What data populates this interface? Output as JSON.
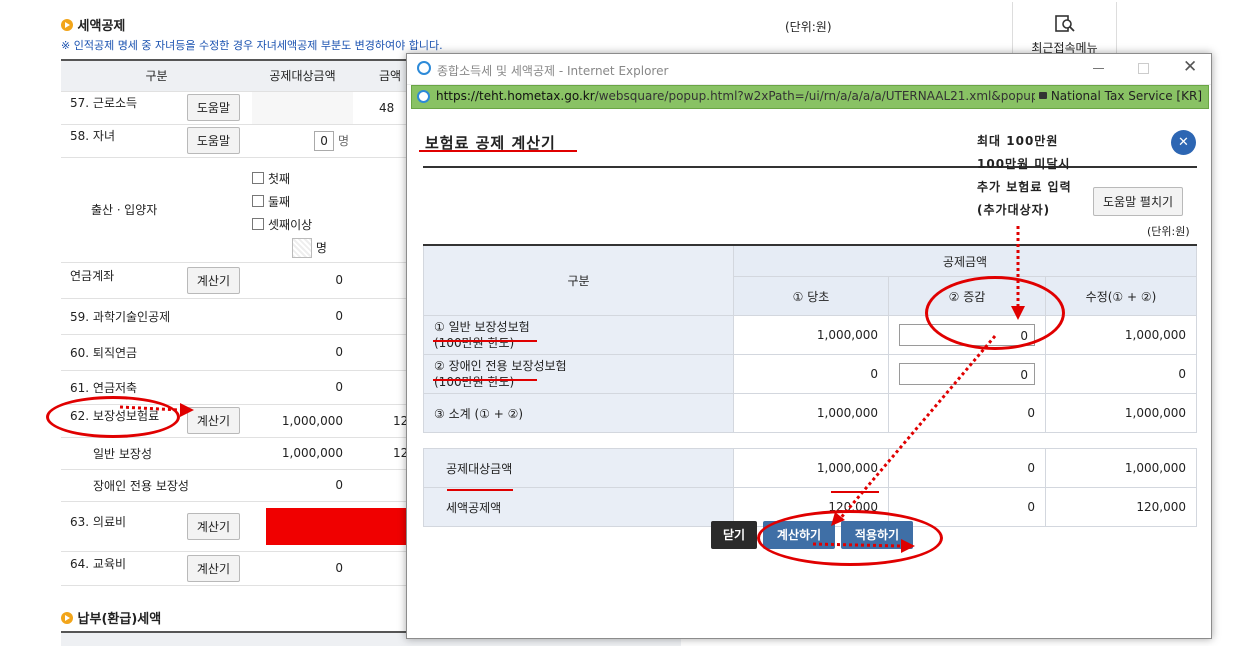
{
  "section": {
    "title": "세액공제",
    "unit": "(단위:원)",
    "notice": "※ 인적공제 명세 중 자녀등을 수정한 경우 자녀세액공제 부분도 변경하여야 합니다."
  },
  "recent_menu": {
    "label": "최근접속메뉴",
    "icon": "document-search-icon"
  },
  "table": {
    "headers": [
      "구분",
      "공제대상금액",
      "금액"
    ],
    "rows": [
      {
        "label": "57. 근로소득",
        "button": "도움말",
        "amount": "",
        "partial": "48"
      },
      {
        "label": "58. 자녀",
        "button": "도움말",
        "count": "0",
        "count_unit": "명",
        "amount": "",
        "partial": ""
      },
      {
        "label": "출산ㆍ입양자",
        "checks": [
          "첫째",
          "둘째",
          "셋째이상"
        ],
        "count_unit": "명"
      },
      {
        "label": "연금계좌",
        "button": "계산기",
        "amount": "0"
      },
      {
        "label": "59. 과학기술인공제",
        "amount": "0"
      },
      {
        "label": "60. 퇴직연금",
        "amount": "0"
      },
      {
        "label": "61. 연금저축",
        "amount": "0"
      },
      {
        "label": "62. 보장성보험료",
        "button": "계산기",
        "amount": "1,000,000",
        "partial": "12"
      },
      {
        "label": "일반 보장성",
        "amount": "1,000,000",
        "partial": "12"
      },
      {
        "label": "장애인 전용 보장성",
        "amount": "0"
      },
      {
        "label": "63. 의료비",
        "button": "계산기"
      },
      {
        "label": "64. 교육비",
        "button": "계산기",
        "amount": "0"
      }
    ]
  },
  "section2": {
    "title": "납부(환급)세액"
  },
  "popup": {
    "window_title": "종합소득세 및 세액공제 - Internet Explorer",
    "url_host": "https://teht.hometax.go.kr",
    "url_path": "/websquare/popup.html?w2xPath=/ui/rn/a/a/a/a/UTERNAAL21.xml&popupID=erinCfrl",
    "site_id": "National Tax Service [KR]",
    "heading": "보험료 공제 계산기",
    "help_button": "도움말 펼치기",
    "unit": "(단위:원)",
    "annotation": [
      "최대 100만원",
      "100만원 미달시",
      "추가 보험료 입력",
      "(추가대상자)"
    ],
    "col_group": "공제금액",
    "col_label": "구분",
    "cols": [
      "① 당초",
      "② 증감",
      "수정(① + ②)"
    ],
    "rows": [
      {
        "label1": "① 일반 보장성보험",
        "label2": "(100만원 한도)",
        "original": "1,000,000",
        "change": "0",
        "revised": "1,000,000"
      },
      {
        "label1": "② 장애인 전용 보장성보험",
        "label2": "(100만원 한도)",
        "original": "0",
        "change": "0",
        "revised": "0"
      },
      {
        "label1": "③ 소계 (① + ②)",
        "original": "1,000,000",
        "change": "0",
        "revised": "1,000,000"
      }
    ],
    "summary": [
      {
        "label": "공제대상금액",
        "original": "1,000,000",
        "change": "0",
        "revised": "1,000,000"
      },
      {
        "label": "세액공제액",
        "original": "120,000",
        "change": "0",
        "revised": "120,000"
      }
    ],
    "buttons": {
      "close": "닫기",
      "calculate": "계산하기",
      "apply": "적용하기"
    }
  },
  "colors": {
    "accent_red": "#e00000",
    "address_green": "#89c264",
    "button_blue": "#3f6fa6",
    "button_dark": "#2b2b2b"
  }
}
